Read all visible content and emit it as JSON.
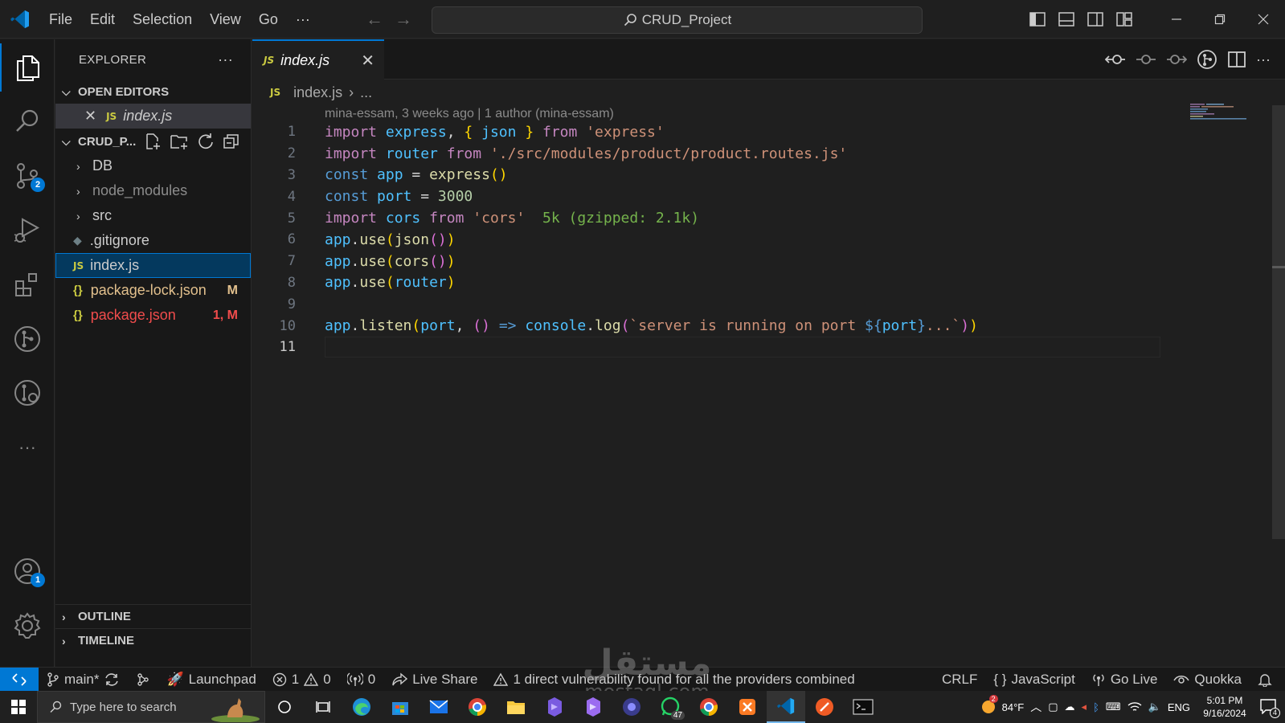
{
  "titlebar": {
    "menu": [
      "File",
      "Edit",
      "Selection",
      "View",
      "Go",
      "···"
    ],
    "search_text": "CRUD_Project"
  },
  "activity": {
    "scm_badge": "2",
    "accounts_badge": "1",
    "more": "···"
  },
  "explorer": {
    "title": "EXPLORER",
    "more": "···",
    "open_editors_label": "OPEN EDITORS",
    "open_editor_file": "index.js",
    "project_label": "CRUD_P...",
    "tree": [
      {
        "name": "DB",
        "kind": "folder"
      },
      {
        "name": "node_modules",
        "kind": "folder"
      },
      {
        "name": "src",
        "kind": "folder"
      },
      {
        "name": ".gitignore",
        "kind": "git"
      },
      {
        "name": "index.js",
        "kind": "js"
      },
      {
        "name": "package-lock.json",
        "kind": "json",
        "deco": "M"
      },
      {
        "name": "package.json",
        "kind": "json",
        "deco": "1, M"
      }
    ],
    "outline_label": "OUTLINE",
    "timeline_label": "TIMELINE"
  },
  "editor": {
    "tab_label": "index.js",
    "tab_icon": "JS",
    "breadcrumb_file": "index.js",
    "breadcrumb_more": "...",
    "blame": "mina-essam, 3 weeks ago | 1 author (mina-essam)",
    "line_numbers": [
      "1",
      "2",
      "3",
      "4",
      "5",
      "6",
      "7",
      "8",
      "9",
      "10",
      "11"
    ],
    "lines": [
      [
        [
          "kw",
          "import"
        ],
        [
          "plain",
          " "
        ],
        [
          "var",
          "express"
        ],
        [
          "plain",
          ", "
        ],
        [
          "br1",
          "{"
        ],
        [
          "plain",
          " "
        ],
        [
          "var",
          "json"
        ],
        [
          "plain",
          " "
        ],
        [
          "br1",
          "}"
        ],
        [
          "plain",
          " "
        ],
        [
          "kw",
          "from"
        ],
        [
          "plain",
          " "
        ],
        [
          "str",
          "'express'"
        ]
      ],
      [
        [
          "kw",
          "import"
        ],
        [
          "plain",
          " "
        ],
        [
          "var",
          "router"
        ],
        [
          "plain",
          " "
        ],
        [
          "kw",
          "from"
        ],
        [
          "plain",
          " "
        ],
        [
          "str",
          "'./src/modules/product/product.routes.js'"
        ]
      ],
      [
        [
          "kw2",
          "const"
        ],
        [
          "plain",
          " "
        ],
        [
          "cst",
          "app"
        ],
        [
          "plain",
          " = "
        ],
        [
          "fn",
          "express"
        ],
        [
          "br1",
          "()"
        ]
      ],
      [
        [
          "kw2",
          "const"
        ],
        [
          "plain",
          " "
        ],
        [
          "cst",
          "port"
        ],
        [
          "plain",
          " = "
        ],
        [
          "num",
          "3000"
        ]
      ],
      [
        [
          "kw",
          "import"
        ],
        [
          "plain",
          " "
        ],
        [
          "var",
          "cors"
        ],
        [
          "plain",
          " "
        ],
        [
          "kw",
          "from"
        ],
        [
          "plain",
          " "
        ],
        [
          "str",
          "'cors'"
        ],
        [
          "plain",
          "  "
        ],
        [
          "size",
          "5k (gzipped: 2.1k)"
        ]
      ],
      [
        [
          "cst",
          "app"
        ],
        [
          "plain",
          "."
        ],
        [
          "fn",
          "use"
        ],
        [
          "br1",
          "("
        ],
        [
          "fn",
          "json"
        ],
        [
          "br2",
          "()"
        ],
        [
          "br1",
          ")"
        ]
      ],
      [
        [
          "cst",
          "app"
        ],
        [
          "plain",
          "."
        ],
        [
          "fn",
          "use"
        ],
        [
          "br1",
          "("
        ],
        [
          "fn",
          "cors"
        ],
        [
          "br2",
          "()"
        ],
        [
          "br1",
          ")"
        ]
      ],
      [
        [
          "cst",
          "app"
        ],
        [
          "plain",
          "."
        ],
        [
          "fn",
          "use"
        ],
        [
          "br1",
          "("
        ],
        [
          "var",
          "router"
        ],
        [
          "br1",
          ")"
        ]
      ],
      [],
      [
        [
          "cst",
          "app"
        ],
        [
          "plain",
          "."
        ],
        [
          "fn",
          "listen"
        ],
        [
          "br1",
          "("
        ],
        [
          "var",
          "port"
        ],
        [
          "plain",
          ", "
        ],
        [
          "br2",
          "()"
        ],
        [
          "plain",
          " "
        ],
        [
          "kw2",
          "=>"
        ],
        [
          "plain",
          " "
        ],
        [
          "var",
          "console"
        ],
        [
          "plain",
          "."
        ],
        [
          "fn",
          "log"
        ],
        [
          "br2",
          "("
        ],
        [
          "tpl",
          "`server is running on port "
        ],
        [
          "kw2",
          "${"
        ],
        [
          "var",
          "port"
        ],
        [
          "kw2",
          "}"
        ],
        [
          "tpl",
          "...`"
        ],
        [
          "br2",
          ")"
        ],
        [
          "br1",
          ")"
        ]
      ],
      []
    ]
  },
  "status": {
    "branch": "main*",
    "launchpad": "Launchpad",
    "errors": "1",
    "warnings": "0",
    "ports": "0",
    "live_share": "Live Share",
    "vuln": "1 direct vulnerability found for all the providers combined",
    "eol": "CRLF",
    "language": "JavaScript",
    "go_live": "Go Live",
    "quokka": "Quokka"
  },
  "taskbar": {
    "search_placeholder": "Type here to search",
    "whatsapp_badge": "47",
    "weather_badge": "2",
    "temp": "84°F",
    "lang": "ENG",
    "time": "5:01 PM",
    "date": "9/16/2024",
    "notif_count": "4"
  },
  "watermark": {
    "line1": "مستقل",
    "line2": "mostaql.com"
  }
}
